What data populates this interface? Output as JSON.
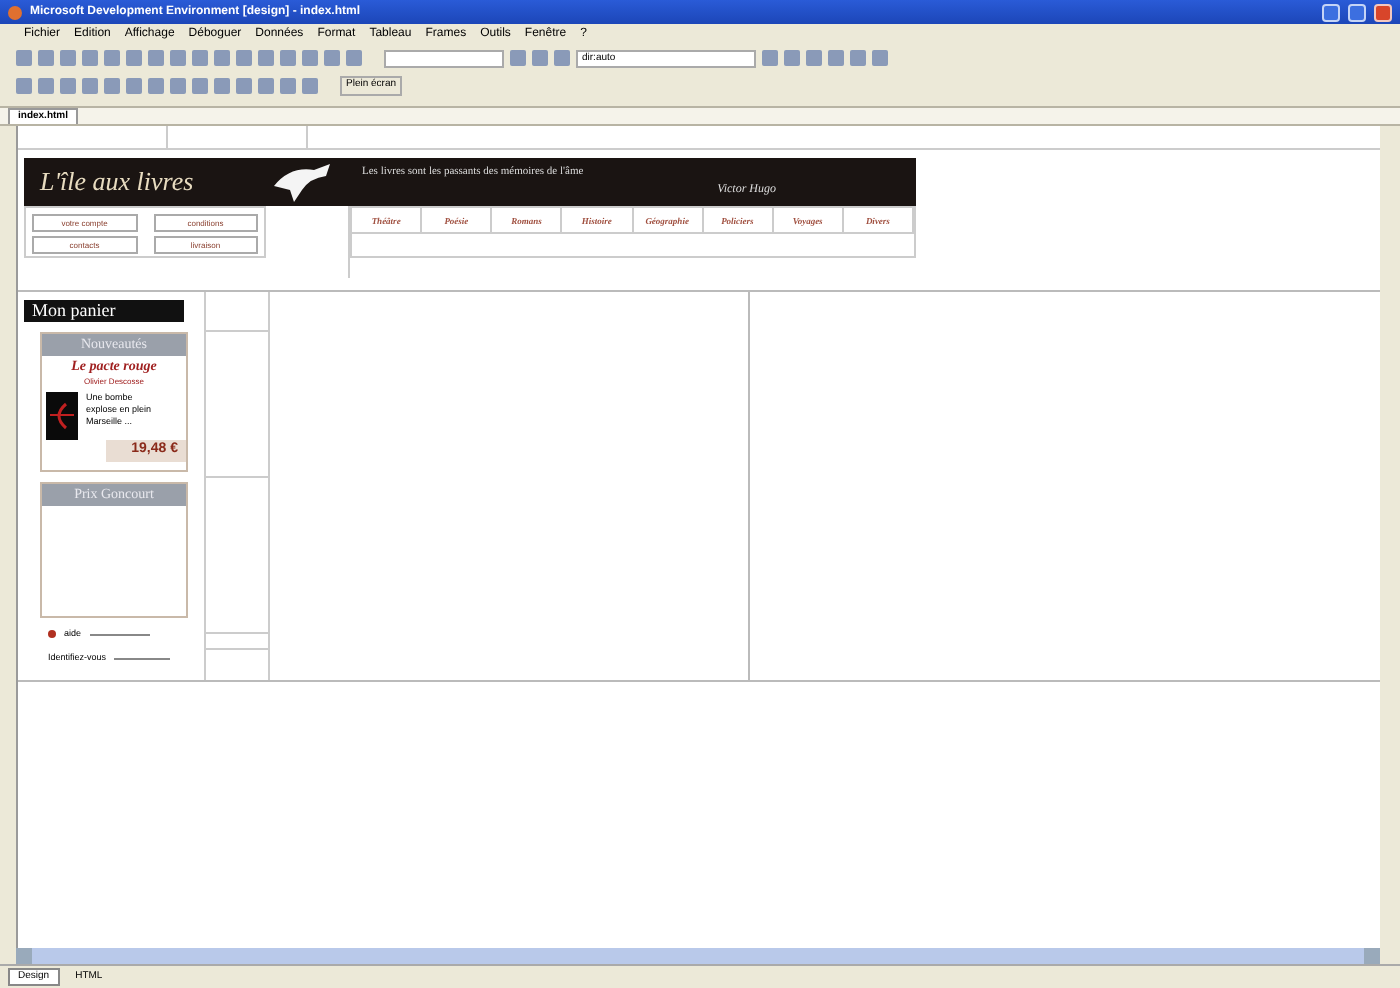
{
  "window": {
    "title": "Microsoft Development Environment [design] - index.html"
  },
  "menu": [
    "Fichier",
    "Edition",
    "Affichage",
    "Déboguer",
    "Données",
    "Format",
    "Tableau",
    "Frames",
    "Outils",
    "Fenêtre",
    "?"
  ],
  "toolbar": {
    "style_box": "dir:auto",
    "full_screen": "Plein écran"
  },
  "doc_tabs": [
    {
      "label": "index.html",
      "selected": true
    }
  ],
  "site": {
    "logo": "L'île aux livres",
    "account_links": [
      "votre compte",
      "conditions",
      "contacts",
      "livraison"
    ],
    "quote": "Les livres sont les passants des mémoires de l'âme",
    "quote_author": "Victor Hugo",
    "nav": [
      "Théâtre",
      "Poésie",
      "Romans",
      "Histoire",
      "Géographie",
      "Policiers",
      "Voyages",
      "Divers"
    ],
    "cart": "Mon panier",
    "news": {
      "heading": "Nouveautés",
      "book_title": "Le pacte rouge",
      "author": "Olivier Descosse",
      "blurb": "Une bombe explose en plein Marseille ...",
      "price": "19,48 €"
    },
    "prize": {
      "heading": "Prix Goncourt"
    },
    "help": "aide",
    "login": "Identifiez-vous"
  },
  "view_tabs": [
    {
      "label": "Design",
      "selected": true
    },
    {
      "label": "HTML",
      "selected": false
    }
  ]
}
